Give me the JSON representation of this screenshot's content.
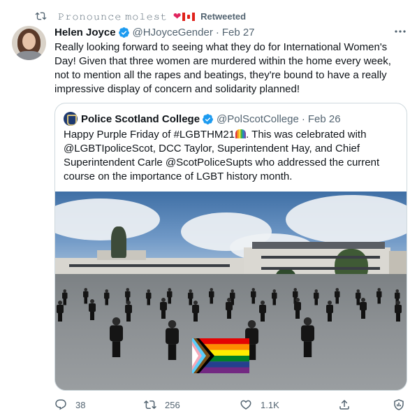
{
  "retweet": {
    "icon": "retweet-icon",
    "name": "𝙿𝚛𝚘𝚗𝚘𝚞𝚗𝚌𝚎 𝚖𝚘𝚕𝚎𝚜𝚝",
    "label": "Retweeted"
  },
  "tweet": {
    "author_name": "Helen Joyce",
    "handle": "@HJoyceGender",
    "separator": "·",
    "date": "Feb 27",
    "text": "Really looking forward to seeing what they do for International Women's Day! Given that three women are murdered within the home every week, not to mention all the rapes and beatings, they're bound to have a really impressive display of concern and solidarity planned!"
  },
  "quote": {
    "author_name": "Police Scotland College",
    "handle": "@PolScotCollege",
    "separator": "·",
    "date": "Feb 26",
    "text_before": "Happy Purple Friday of #LGBTHM21",
    "text_after": ".  This was celebrated with @LGBTIpoliceScot, DCC Taylor, Superintendent Hay, and Chief Superintendent Carle @ScotPoliceSupts who addressed the current course on the importance of LGBT history month."
  },
  "actions": {
    "reply_count": "38",
    "retweet_count": "256",
    "like_count": "1.1K"
  },
  "colors": {
    "verified": "#1d9bf0",
    "muted": "#536471",
    "heart": "#e0245e",
    "border": "#cfd9de"
  }
}
